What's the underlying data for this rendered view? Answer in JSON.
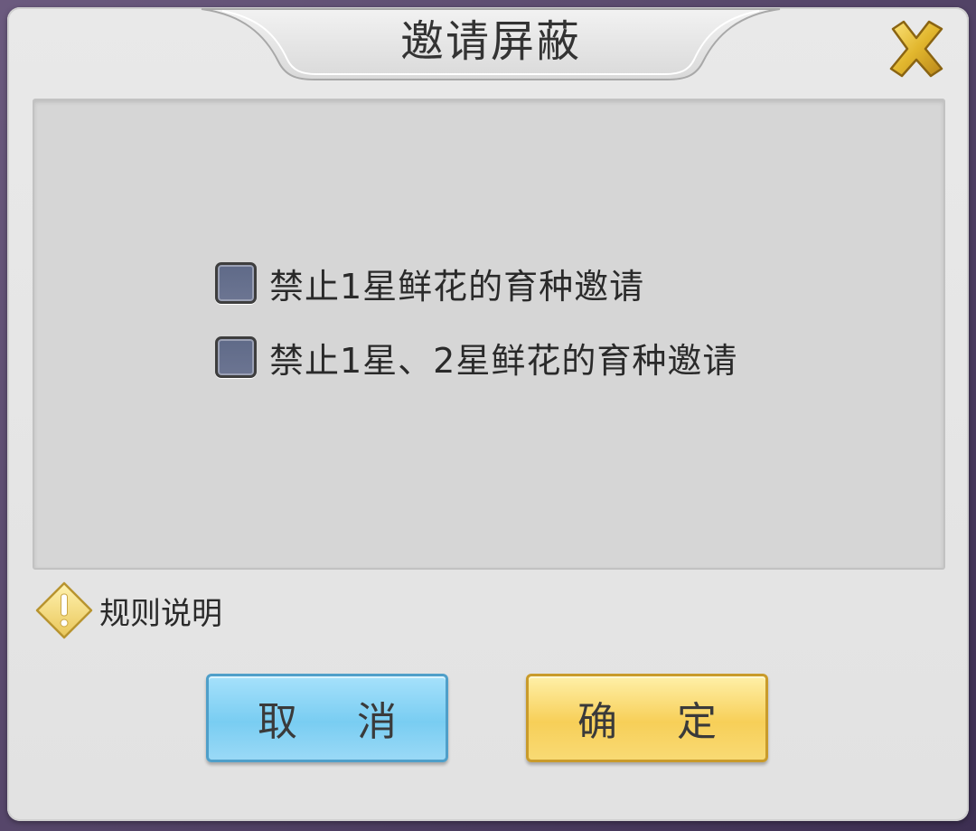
{
  "dialog": {
    "title": "邀请屏蔽",
    "close_icon": "close-x-icon"
  },
  "options": [
    {
      "label": "禁止1星鲜花的育种邀请",
      "checked": false
    },
    {
      "label": "禁止1星、2星鲜花的育种邀请",
      "checked": false
    }
  ],
  "rules": {
    "label": "规则说明",
    "icon": "warning-diamond-icon"
  },
  "buttons": {
    "cancel_label": "取 消",
    "confirm_label": "确 定"
  },
  "colors": {
    "checkbox_fill": "#6c7592",
    "cancel_button": "#79cdf2",
    "confirm_button": "#f7cf58",
    "close_icon": "#e2b72e"
  }
}
